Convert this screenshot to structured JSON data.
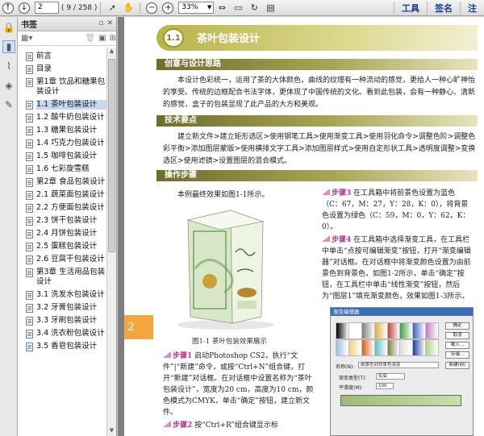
{
  "toolbar": {
    "page_current": "2",
    "page_total": "( 9 / 258 )",
    "zoom": "33%",
    "right_menu": [
      "工具",
      "签名",
      "注"
    ]
  },
  "bookmarks": {
    "title": "书签",
    "items": [
      {
        "label": "前言",
        "selected": false
      },
      {
        "label": "目录",
        "selected": false
      },
      {
        "label": "第1章  饮品和糖果包装设计",
        "selected": false
      },
      {
        "label": "1.1  茶叶包装设计",
        "selected": true
      },
      {
        "label": "1.2  酸牛奶包装设计",
        "selected": false
      },
      {
        "label": "1.3  糖果包装设计",
        "selected": false
      },
      {
        "label": "1.4  巧克力包装设计",
        "selected": false
      },
      {
        "label": "1.5  咖啡包装设计",
        "selected": false
      },
      {
        "label": "1.6  七彩旋雪糕",
        "selected": false
      },
      {
        "label": "第2章  食品包装设计",
        "selected": false
      },
      {
        "label": "2.1  蔬菜面包装设计",
        "selected": false
      },
      {
        "label": "2.2  方便面包装设计",
        "selected": false
      },
      {
        "label": "2.3  饼干包装设计",
        "selected": false
      },
      {
        "label": "2.4  月饼包装设计",
        "selected": false
      },
      {
        "label": "2.5  蛋糕包装设计",
        "selected": false
      },
      {
        "label": "2.6  豆腐干包装设计",
        "selected": false
      },
      {
        "label": "第3章  生活用品包装设计",
        "selected": false
      },
      {
        "label": "3.1  洗发水包装设计",
        "selected": false
      },
      {
        "label": "3.2  牙膏包装设计",
        "selected": false
      },
      {
        "label": "3.3  牙刷包装设计",
        "selected": false
      },
      {
        "label": "3.4  洗衣粉包装设计",
        "selected": false
      },
      {
        "label": "3.5  香皂包装设计",
        "selected": false
      }
    ]
  },
  "page": {
    "tab_number": "2",
    "chapter_number": "1.1",
    "chapter_title": "茶叶包装设计",
    "sec1_title": "创意与设计思路",
    "sec1_text": "本设计色彩统一，运用了茶的大体颜色，曲线的纹理有一种流动的感觉，更给人一种心旷神怡的享受。传统的边框配合书法字体，更体现了中国传统的文化。看到此包装，会有一种静心、清新的感觉，盒子的包装显现了此产品的大方和美观。",
    "sec2_title": "技术要点",
    "sec2_text": "建立新文件>建立矩形选区>使用钢笔工具>使用渐变工具>使用羽化命令>调整色阶>调整色彩平衡>添加图层蒙版>使用横排文字工具>添加图层样式>使用自定形状工具>透明度调整>变换选区>使用滤镜>设置图层的混合模式。",
    "sec3_title": "操作步骤",
    "intro": "本例最终效果如图1-1所示。",
    "fig_caption": "图1-1   茶叶包装效果展示",
    "step1_label": "步骤1",
    "step1_text": "启动Photoshop CS2，执行“文件”|“新建”命令，或按“Ctrl+N”组合键，打开“新建”对话框。在对话框中设置名称为“茶叶包装设计”，宽度为20 cm，高度为10 cm，颜色模式为CMYK，单击“确定”按钮，建立新文件。",
    "step2_label": "步骤2",
    "step2_text": "按“Ctrl+R”组合键显示标",
    "step3_label": "步骤3",
    "step3_text": "在工具箱中将前景色设置为蓝色（C：67，M：27，Y：28，K：0），将背景色设置为绿色（C：59，M：0，Y：62，K：0）。",
    "step4_label": "步骤4",
    "step4_text": "在工具箱中选择渐变工具，在工具栏中单击“点按可编辑渐变”按钮，打开“渐变编辑器”对话框。在对话框中将渐变颜色设置为由前景色到背景色，如图1-2所示，单击“确定”按钮，在工具栏中单击“线性渐变”按钮，然后为“图层1”填充渐变颜色，效果如图1-3所示。"
  },
  "dialog": {
    "title": "渐变编辑器",
    "buttons": [
      "确定",
      "取消",
      "载入...",
      "存储..."
    ],
    "name_label": "名称(N):",
    "name_value": "前景色到背景色渐变",
    "new_button": "新建(W)",
    "type_label": "渐变类型(T):",
    "type_value": "实底",
    "smooth_label": "平滑度(M):",
    "smooth_value": "100",
    "swatch_colors": [
      "#000000",
      "#ffffff",
      "#7f7f7f",
      "#e0b040",
      "#c04040",
      "#40a040",
      "#4060c0",
      "#c080c0",
      "#a0c0e0",
      "#f0d080",
      "#d06020",
      "#60c0c0",
      "#808040",
      "#e0e0e0",
      "#2040a0",
      "#b0d090"
    ]
  }
}
